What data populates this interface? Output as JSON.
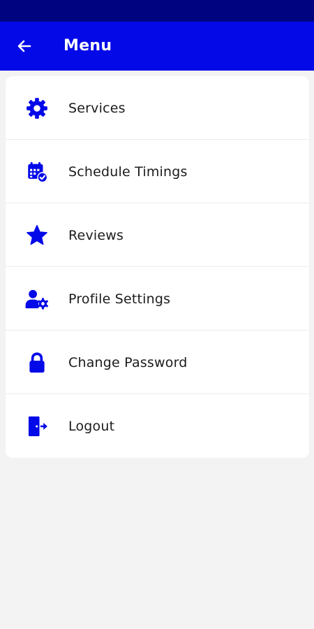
{
  "colors": {
    "status_bar": "#00037f",
    "app_bar": "#0409e8",
    "icon": "#0409e8",
    "background": "#f3f3f3",
    "card": "#ffffff",
    "text": "#1b1b1b"
  },
  "header": {
    "back_icon": "arrow-left-icon",
    "title": "Menu"
  },
  "menu": {
    "items": [
      {
        "label": "Services",
        "icon": "gear-icon"
      },
      {
        "label": "Schedule Timings",
        "icon": "calendar-check-icon"
      },
      {
        "label": "Reviews",
        "icon": "star-icon"
      },
      {
        "label": "Profile Settings",
        "icon": "user-gear-icon"
      },
      {
        "label": "Change Password",
        "icon": "lock-icon"
      },
      {
        "label": "Logout",
        "icon": "door-exit-icon"
      }
    ]
  }
}
